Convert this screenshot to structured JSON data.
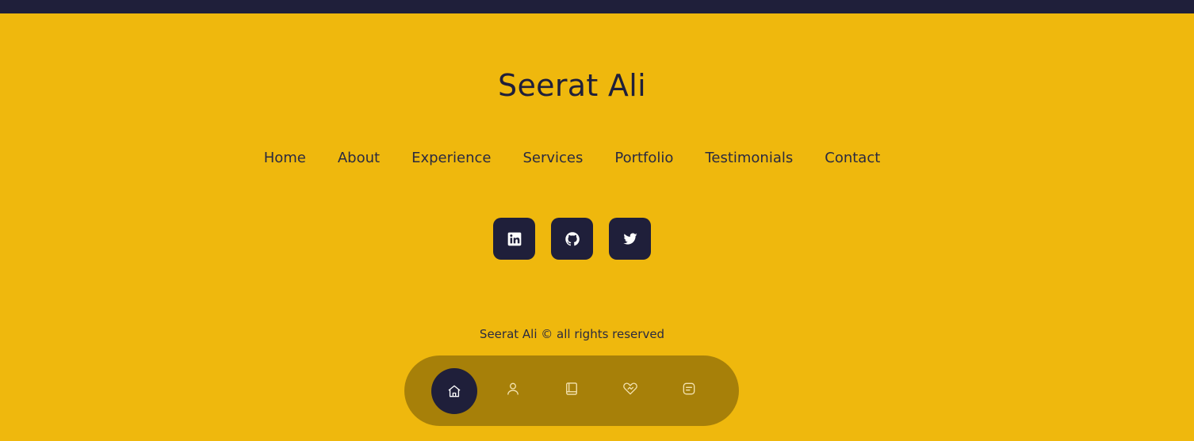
{
  "colors": {
    "background": "#efb80d",
    "dark": "#1f1f3a",
    "icon_light": "#f4e2b0"
  },
  "footer": {
    "title": "Seerat Ali",
    "nav": [
      {
        "label": "Home"
      },
      {
        "label": "About"
      },
      {
        "label": "Experience"
      },
      {
        "label": "Services"
      },
      {
        "label": "Portfolio"
      },
      {
        "label": "Testimonials"
      },
      {
        "label": "Contact"
      }
    ],
    "socials": [
      {
        "icon": "linkedin-icon"
      },
      {
        "icon": "github-icon"
      },
      {
        "icon": "twitter-icon"
      }
    ],
    "copyright": "Seerat Ali © all rights reserved"
  },
  "bottom_nav": {
    "items": [
      {
        "icon": "home-icon",
        "active": true
      },
      {
        "icon": "user-icon",
        "active": false
      },
      {
        "icon": "book-icon",
        "active": false
      },
      {
        "icon": "handshake-icon",
        "active": false
      },
      {
        "icon": "message-icon",
        "active": false
      }
    ]
  }
}
